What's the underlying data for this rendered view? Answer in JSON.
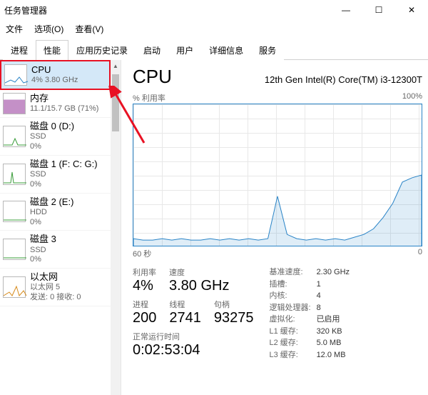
{
  "chart_data": {
    "type": "line",
    "title": "% 利用率",
    "ylim": [
      0,
      100
    ],
    "xlabel": "60 秒",
    "x": [
      0,
      2,
      4,
      6,
      8,
      10,
      12,
      14,
      16,
      18,
      20,
      22,
      24,
      26,
      28,
      30,
      32,
      34,
      36,
      38,
      40,
      42,
      44,
      46,
      48,
      50,
      52,
      54,
      56,
      58,
      60
    ],
    "values": [
      5,
      4,
      4,
      5,
      4,
      5,
      4,
      4,
      5,
      4,
      5,
      4,
      5,
      4,
      5,
      35,
      8,
      5,
      4,
      5,
      4,
      5,
      4,
      6,
      8,
      12,
      20,
      30,
      45,
      48,
      50
    ]
  },
  "window": {
    "title": "任务管理器"
  },
  "win_controls": {
    "min": "—",
    "max": "☐",
    "close": "✕"
  },
  "menu": {
    "file": "文件",
    "options": "选项(O)",
    "view": "查看(V)"
  },
  "tabs": {
    "processes": "进程",
    "performance": "性能",
    "history": "应用历史记录",
    "startup": "启动",
    "users": "用户",
    "details": "详细信息",
    "services": "服务"
  },
  "sidebar": {
    "cpu": {
      "title": "CPU",
      "sub": "4% 3.80 GHz"
    },
    "mem": {
      "title": "内存",
      "sub": "11.1/15.7 GB (71%)"
    },
    "disk0": {
      "title": "磁盘 0 (D:)",
      "sub1": "SSD",
      "sub2": "0%"
    },
    "disk1": {
      "title": "磁盘 1 (F: C: G:)",
      "sub1": "SSD",
      "sub2": "0%"
    },
    "disk2": {
      "title": "磁盘 2 (E:)",
      "sub1": "HDD",
      "sub2": "0%"
    },
    "disk3": {
      "title": "磁盘 3",
      "sub1": "SSD",
      "sub2": "0%"
    },
    "eth": {
      "title": "以太网",
      "sub1": "以太网 5",
      "sub2": "发送: 0 接收: 0 "
    }
  },
  "panel": {
    "title": "CPU",
    "desc": "12th Gen Intel(R) Core(TM) i3-12300T",
    "util_label": "% 利用率",
    "util_max": "100%",
    "x_left": "60 秒",
    "x_right": "0",
    "fields": {
      "util_lbl": "利用率",
      "util_val": "4%",
      "speed_lbl": "速度",
      "speed_val": "3.80 GHz",
      "proc_lbl": "进程",
      "proc_val": "200",
      "thr_lbl": "线程",
      "thr_val": "2741",
      "hnd_lbl": "句柄",
      "hnd_val": "93275"
    },
    "right": {
      "base_lbl": "基准速度:",
      "base_val": "2.30 GHz",
      "sock_lbl": "插槽:",
      "sock_val": "1",
      "core_lbl": "内核:",
      "core_val": "4",
      "lproc_lbl": "逻辑处理器:",
      "lproc_val": "8",
      "virt_lbl": "虚拟化:",
      "virt_val": "已启用",
      "l1_lbl": "L1 缓存:",
      "l1_val": "320 KB",
      "l2_lbl": "L2 缓存:",
      "l2_val": "5.0 MB",
      "l3_lbl": "L3 缓存:",
      "l3_val": "12.0 MB"
    },
    "uptime_lbl": "正常运行时间",
    "uptime_val": "0:02:53:04"
  }
}
